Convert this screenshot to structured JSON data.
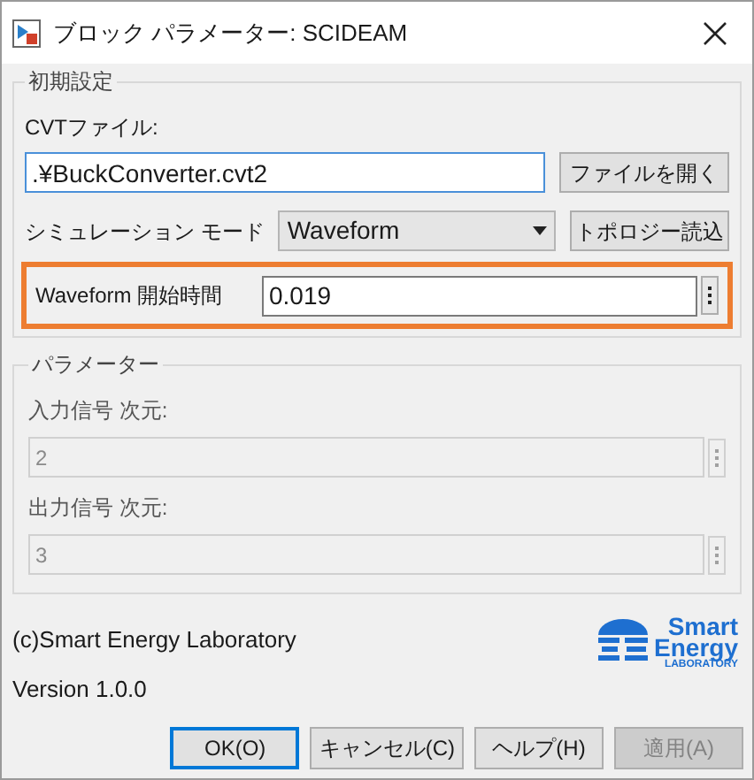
{
  "window": {
    "title": "ブロック パラメーター: SCIDEAM"
  },
  "initial_settings": {
    "title": "初期設定",
    "cvt_label": "CVTファイル:",
    "cvt_value": ".¥BuckConverter.cvt2",
    "open_button": "ファイルを開く",
    "mode_label": "シミュレーション モード",
    "mode_value": "Waveform",
    "topology_button": "トポロジー読込",
    "start_label": "Waveform 開始時間",
    "start_value": "0.019",
    "start_highlighted": true
  },
  "parameters": {
    "title": "パラメーター",
    "fields": [
      {
        "label": "入力信号 次元:",
        "value": "2",
        "disabled": true
      },
      {
        "label": "出力信号 次元:",
        "value": "3",
        "disabled": true
      }
    ]
  },
  "footer": {
    "copyright": "(c)Smart Energy Laboratory",
    "version": "Version 1.0.0",
    "logo": [
      "Smart",
      "Energy",
      "LABORATORY"
    ]
  },
  "buttons": [
    {
      "label": "OK(O)",
      "default": true,
      "disabled": false
    },
    {
      "label": "キャンセル(C)",
      "default": false,
      "disabled": false
    },
    {
      "label": "ヘルプ(H)",
      "default": false,
      "disabled": false
    },
    {
      "label": "適用(A)",
      "default": false,
      "disabled": true
    }
  ]
}
